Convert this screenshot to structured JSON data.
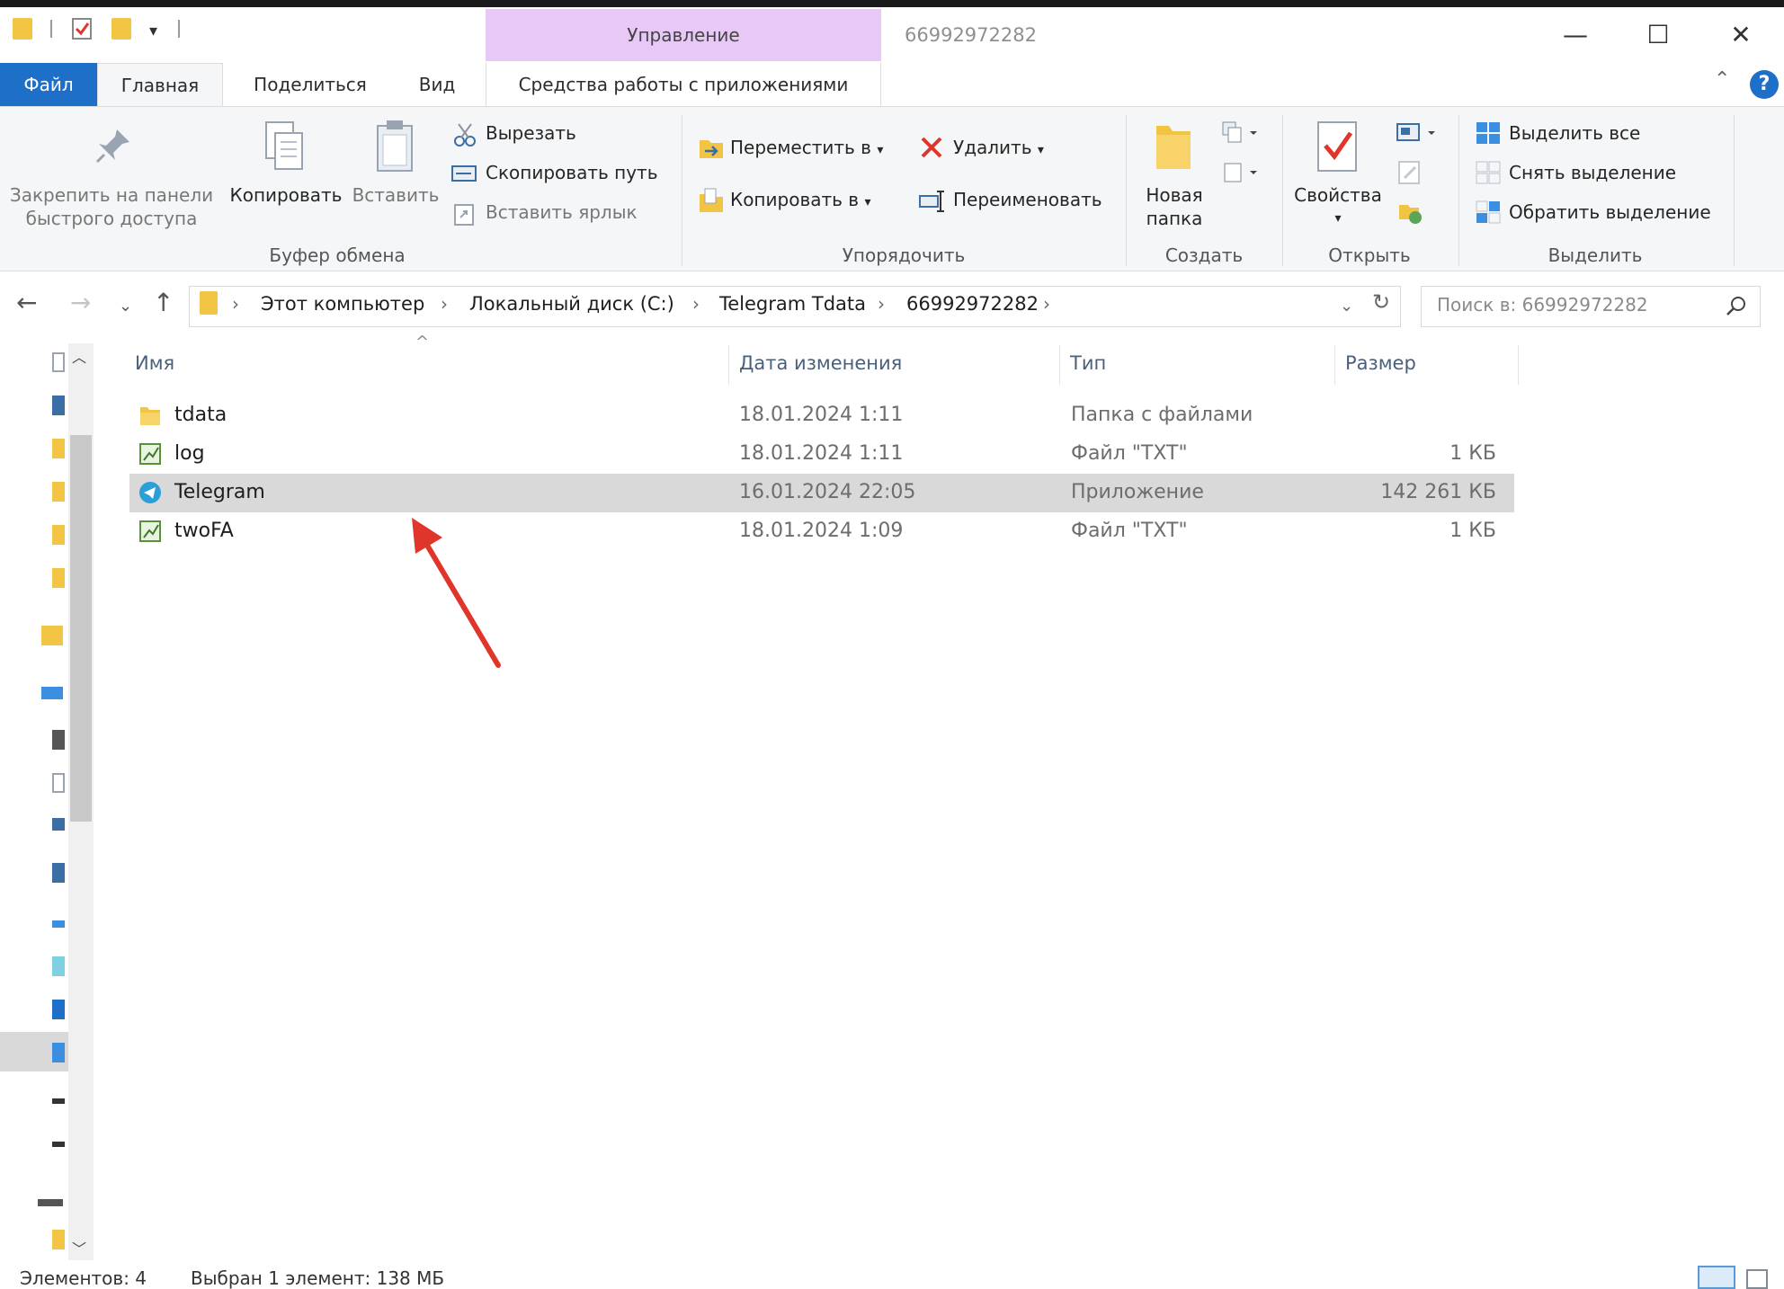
{
  "window": {
    "title": "66992972282",
    "context_tab": "Управление",
    "controls": {
      "minimize": "—",
      "maximize": "☐",
      "close": "✕"
    }
  },
  "ribbon": {
    "tabs": {
      "file": "Файл",
      "home": "Главная",
      "share": "Поделиться",
      "view": "Вид",
      "app_tools": "Средства работы с приложениями"
    },
    "clipboard": {
      "pin_line1": "Закрепить на панели",
      "pin_line2": "быстрого доступа",
      "copy": "Копировать",
      "paste": "Вставить",
      "cut": "Вырезать",
      "copy_path": "Скопировать путь",
      "paste_shortcut": "Вставить ярлык",
      "group": "Буфер обмена"
    },
    "organize": {
      "move_to": "Переместить в",
      "copy_to": "Копировать в",
      "delete": "Удалить",
      "rename": "Переименовать",
      "group": "Упорядочить"
    },
    "new": {
      "new_folder_line1": "Новая",
      "new_folder_line2": "папка",
      "group": "Создать"
    },
    "open": {
      "properties": "Свойства",
      "group": "Открыть"
    },
    "select": {
      "select_all": "Выделить все",
      "select_none": "Снять выделение",
      "invert": "Обратить выделение",
      "group": "Выделить"
    }
  },
  "address": {
    "crumbs": [
      "Этот компьютер",
      "Локальный диск (C:)",
      "Telegram Tdata",
      "66992972282"
    ],
    "search_placeholder": "Поиск в: 66992972282"
  },
  "columns": {
    "name": "Имя",
    "date": "Дата изменения",
    "type": "Тип",
    "size": "Размер"
  },
  "files": [
    {
      "name": "tdata",
      "date": "18.01.2024 1:11",
      "type": "Папка с файлами",
      "size": "",
      "icon": "folder-icon",
      "selected": false
    },
    {
      "name": "log",
      "date": "18.01.2024 1:11",
      "type": "Файл \"TXT\"",
      "size": "1 КБ",
      "icon": "txt-file-icon",
      "selected": false
    },
    {
      "name": "Telegram",
      "date": "16.01.2024 22:05",
      "type": "Приложение",
      "size": "142 261 КБ",
      "icon": "telegram-icon",
      "selected": true
    },
    {
      "name": "twoFA",
      "date": "18.01.2024 1:09",
      "type": "Файл \"TXT\"",
      "size": "1 КБ",
      "icon": "txt-file-icon",
      "selected": false
    }
  ],
  "status": {
    "items": "Элементов: 4",
    "selected": "Выбран 1 элемент: 138 МБ"
  },
  "colors": {
    "accent": "#1e6fc8",
    "context_tab": "#e7c8f6",
    "selection": "#d9d9d9",
    "annotation_arrow": "#e0352b",
    "folder": "#f2c443"
  }
}
